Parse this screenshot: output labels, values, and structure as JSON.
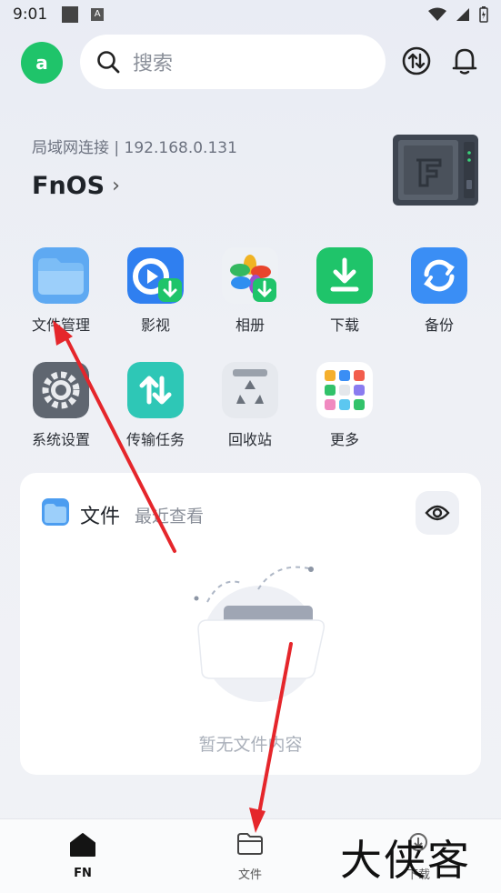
{
  "status_bar": {
    "time": "9:01"
  },
  "header": {
    "avatar_letter": "a",
    "search_placeholder": "搜索"
  },
  "server": {
    "connection": "局域网连接 | 192.168.0.131",
    "name": "FnOS"
  },
  "apps": [
    {
      "label": "文件管理",
      "icon": "folder-icon"
    },
    {
      "label": "影视",
      "icon": "video-icon"
    },
    {
      "label": "相册",
      "icon": "photos-icon"
    },
    {
      "label": "下载",
      "icon": "download-icon"
    },
    {
      "label": "备份",
      "icon": "backup-icon"
    },
    {
      "label": "系统设置",
      "icon": "settings-icon"
    },
    {
      "label": "传输任务",
      "icon": "transfer-icon"
    },
    {
      "label": "回收站",
      "icon": "recycle-bin-icon"
    },
    {
      "label": "更多",
      "icon": "more-apps-icon"
    }
  ],
  "files_card": {
    "title": "文件",
    "subtitle": "最近查看",
    "empty_text": "暂无文件内容"
  },
  "tabs": [
    {
      "label": "FN",
      "icon": "home-icon"
    },
    {
      "label": "文件",
      "icon": "folder-tab-icon"
    },
    {
      "label": "下载",
      "icon": "download-tab-icon"
    }
  ],
  "watermark": "大侠客",
  "colors": {
    "accent_green": "#1fc46a",
    "arrow_red": "#e5262b",
    "page_bg": "#eef0f5"
  }
}
